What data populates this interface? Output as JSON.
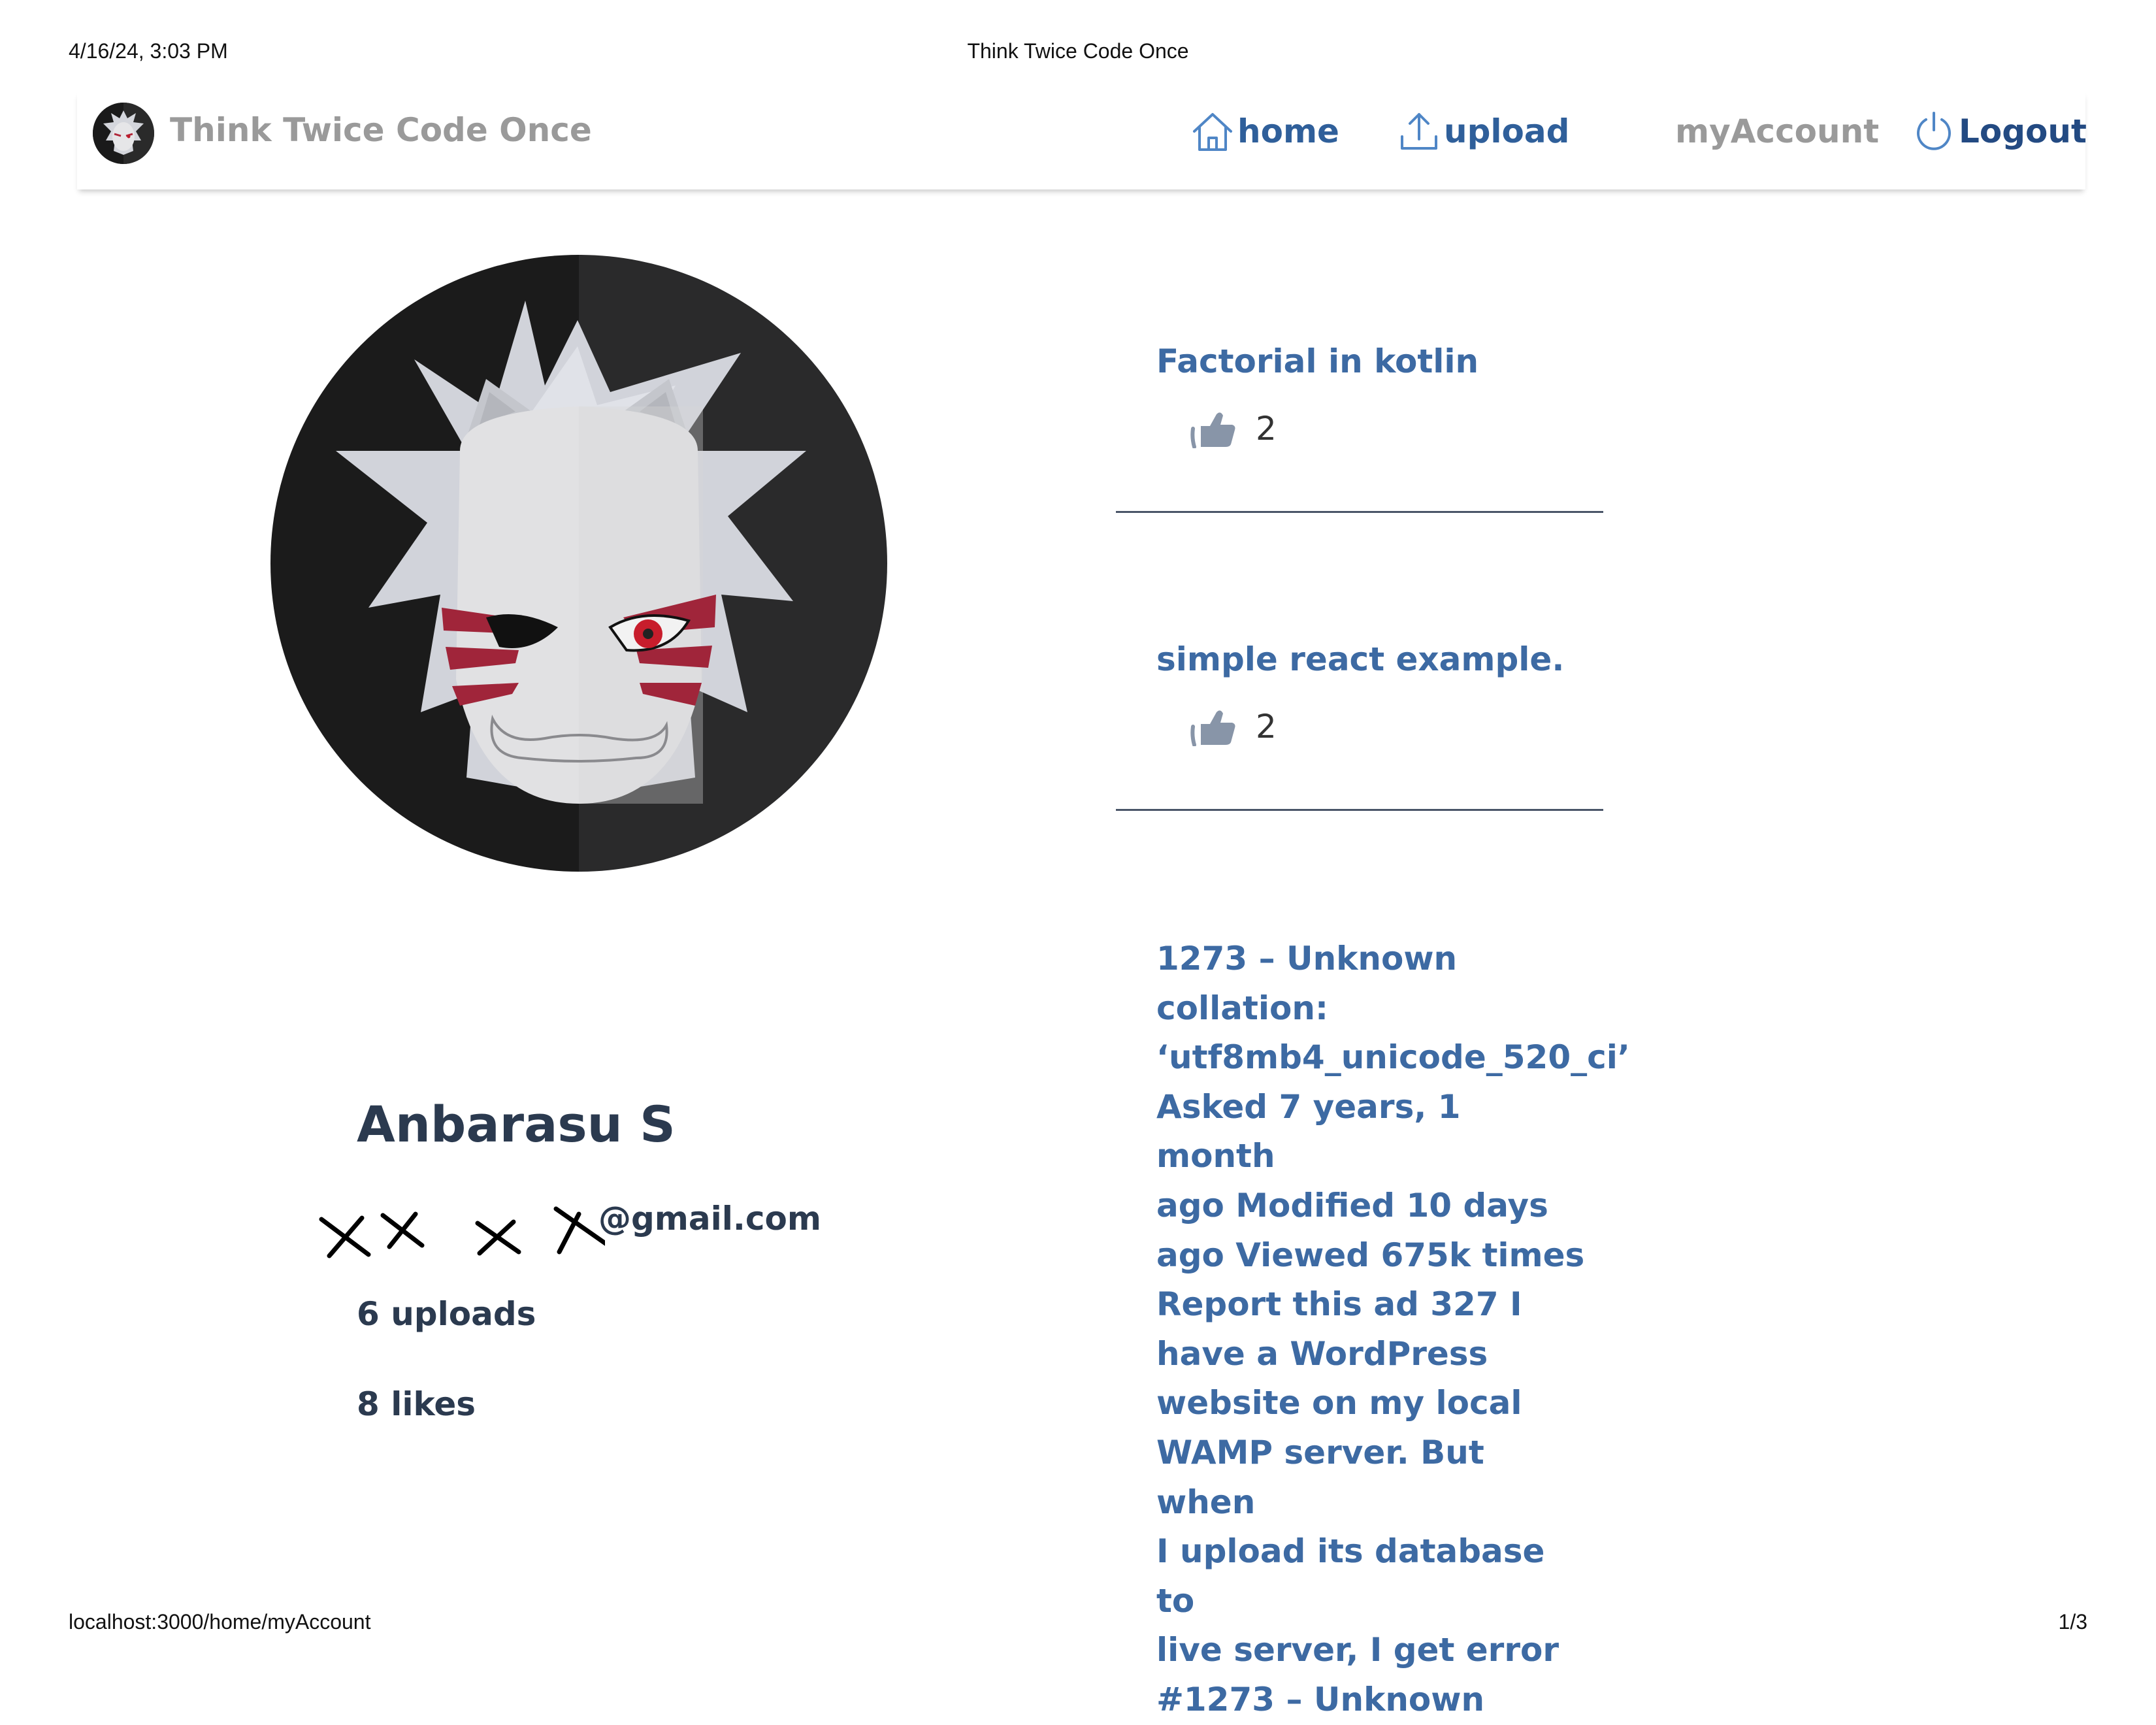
{
  "print": {
    "date": "4/16/24, 3:03 PM",
    "doc_title": "Think Twice Code Once",
    "url": "localhost:3000/home/myAccount",
    "page": "1/3"
  },
  "nav": {
    "brand": "Think Twice Code Once",
    "home": "home",
    "upload": "upload",
    "my_account": "myAccount",
    "logout": "Logout"
  },
  "profile": {
    "name": "Anbarasu S",
    "email": "@gmail.com",
    "uploads": "6 uploads",
    "likes": "8 likes"
  },
  "posts": [
    {
      "title": "Factorial in kotlin",
      "likes": "2"
    },
    {
      "title": "simple react example.",
      "likes": "2"
    },
    {
      "title": "1273 – Unknown\ncollation:\n‘utf8mb4_unicode_520_ci’\nAsked 7 years, 1 month\nago Modified 10 days\nago Viewed 675k times\nReport this ad 327 I\nhave a WordPress\nwebsite on my local\nWAMP server. But when\nI upload its database to\nlive server, I get error\n#1273 – Unknown"
    }
  ],
  "colors": {
    "nav_link": "#2f5f9a",
    "logout": "#234a82",
    "muted": "#9a9a9a",
    "post_title": "#3d6aa3",
    "profile_text": "#2b3a4f",
    "like_icon": "#8895a8"
  },
  "icons": [
    "home-icon",
    "upload-icon",
    "power-icon",
    "thumbs-up-icon"
  ]
}
